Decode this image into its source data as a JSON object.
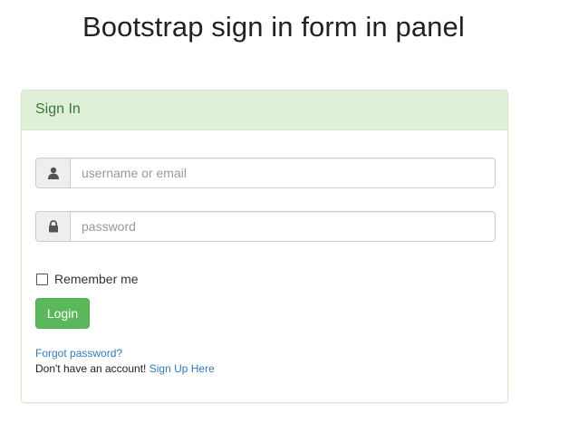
{
  "page": {
    "title": "Bootstrap sign in form in panel"
  },
  "panel": {
    "heading": "Sign In",
    "username": {
      "placeholder": "username or email",
      "value": "",
      "icon": "user-icon"
    },
    "password": {
      "placeholder": "password",
      "value": "",
      "icon": "lock-icon"
    },
    "remember": {
      "label": "Remember me",
      "checked": false
    },
    "login_label": "Login",
    "forgot_label": "Forgot password?",
    "no_account_text": "Don't have an account!",
    "signup_label": "Sign Up Here"
  },
  "colors": {
    "heading_bg": "#dff0d8",
    "heading_text": "#3c763d",
    "panel_border": "#d6e9c6",
    "button_bg": "#5cb85c",
    "link": "#337ab7"
  }
}
